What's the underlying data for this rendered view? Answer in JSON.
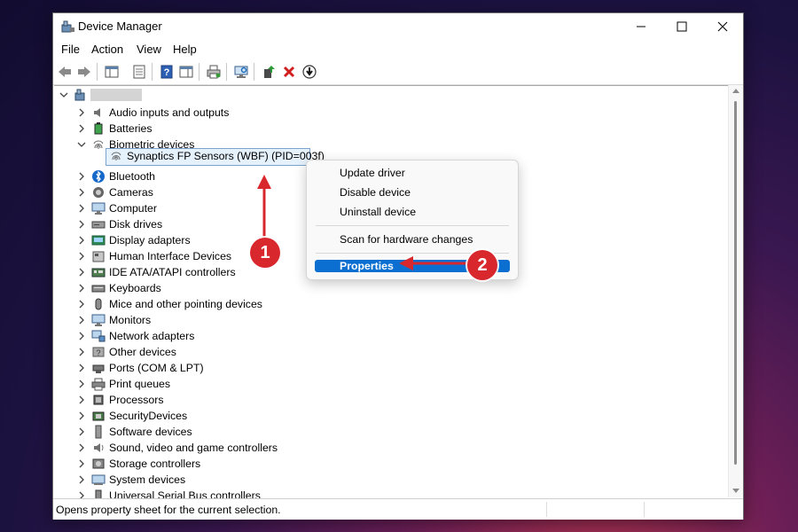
{
  "window": {
    "title": "Device Manager"
  },
  "menu": [
    "File",
    "Action",
    "View",
    "Help"
  ],
  "toolbar_icons": [
    "back-icon",
    "forward-icon",
    "show-hide-console-tree-icon",
    "properties-icon",
    "help-icon",
    "action-pane-icon",
    "print-icon",
    "scan-hardware-icon",
    "update-driver-icon",
    "uninstall-icon",
    "download-icon"
  ],
  "tree": {
    "root_label": "",
    "categories": [
      {
        "label": "Audio inputs and outputs",
        "icon": "speaker-icon",
        "expanded": false
      },
      {
        "label": "Batteries",
        "icon": "battery-icon",
        "expanded": false
      },
      {
        "label": "Biometric devices",
        "icon": "fingerprint-icon",
        "expanded": true
      },
      {
        "label": "Bluetooth",
        "icon": "bluetooth-icon",
        "expanded": false
      },
      {
        "label": "Cameras",
        "icon": "camera-icon",
        "expanded": false
      },
      {
        "label": "Computer",
        "icon": "monitor-icon",
        "expanded": false
      },
      {
        "label": "Disk drives",
        "icon": "disk-drive-icon",
        "expanded": false
      },
      {
        "label": "Display adapters",
        "icon": "display-adapter-icon",
        "expanded": false
      },
      {
        "label": "Human Interface Devices",
        "icon": "hid-icon",
        "expanded": false
      },
      {
        "label": "IDE ATA/ATAPI controllers",
        "icon": "ide-controller-icon",
        "expanded": false
      },
      {
        "label": "Keyboards",
        "icon": "keyboard-icon",
        "expanded": false
      },
      {
        "label": "Mice and other pointing devices",
        "icon": "mouse-icon",
        "expanded": false
      },
      {
        "label": "Monitors",
        "icon": "monitor-icon",
        "expanded": false
      },
      {
        "label": "Network adapters",
        "icon": "network-icon",
        "expanded": false
      },
      {
        "label": "Other devices",
        "icon": "unknown-device-icon",
        "expanded": false
      },
      {
        "label": "Ports (COM & LPT)",
        "icon": "port-icon",
        "expanded": false
      },
      {
        "label": "Print queues",
        "icon": "printer-icon",
        "expanded": false
      },
      {
        "label": "Processors",
        "icon": "processor-icon",
        "expanded": false
      },
      {
        "label": "SecurityDevices",
        "icon": "security-device-icon",
        "expanded": false
      },
      {
        "label": "Software devices",
        "icon": "software-device-icon",
        "expanded": false
      },
      {
        "label": "Sound, video and game controllers",
        "icon": "sound-icon",
        "expanded": false
      },
      {
        "label": "Storage controllers",
        "icon": "storage-icon",
        "expanded": false
      },
      {
        "label": "System devices",
        "icon": "system-device-icon",
        "expanded": false
      },
      {
        "label": "Universal Serial Bus controllers",
        "icon": "usb-icon",
        "expanded": false
      }
    ],
    "child_device": "Synaptics FP Sensors (WBF) (PID=003f)"
  },
  "context_menu": {
    "items": [
      "Update driver",
      "Disable device",
      "Uninstall device",
      "Scan for hardware changes",
      "Properties"
    ],
    "highlighted": "Properties"
  },
  "annotations": {
    "badge1": "1",
    "badge2": "2"
  },
  "status_bar": {
    "text": "Opens property sheet for the current selection."
  },
  "colors": {
    "highlight": "#0a6fd1",
    "badge": "#d9272e",
    "selection_bg": "#e5f1fb"
  }
}
